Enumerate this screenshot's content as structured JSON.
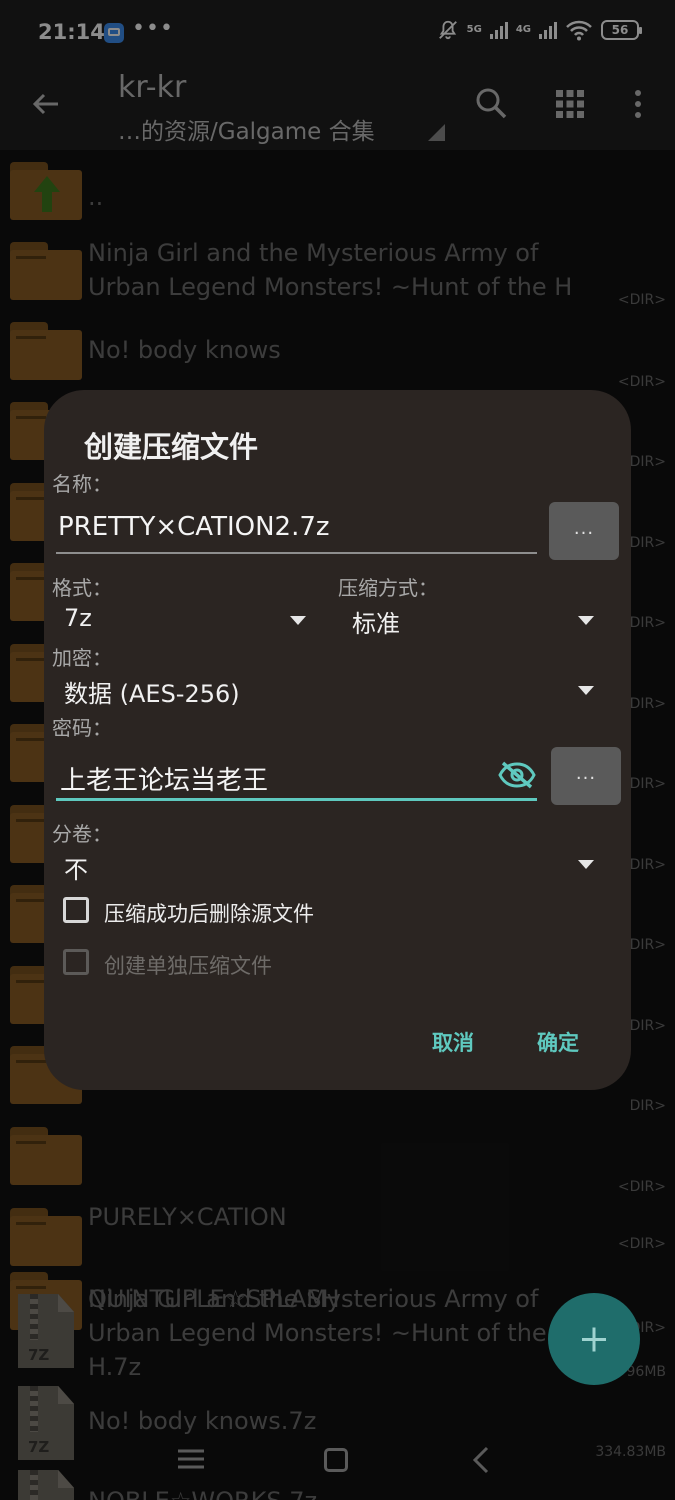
{
  "status_bar": {
    "time": "21:14",
    "dots": "•••",
    "network_5g": "5G",
    "network_4g": "4G",
    "battery": "56"
  },
  "toolbar": {
    "title": "kr-kr",
    "path": "…的资源/Galgame 合集"
  },
  "file_list": [
    {
      "name": "..",
      "meta": "",
      "kind": "up"
    },
    {
      "name_line1": "Ninja Girl and the Mysterious Army of",
      "name_line2": "Urban Legend Monsters! ~Hunt of the H",
      "meta": "<DIR>",
      "kind": "folder"
    },
    {
      "name": "No! body knows",
      "meta": "<DIR>",
      "kind": "folder"
    },
    {
      "name": "",
      "meta": "DIR>",
      "kind": "folder"
    },
    {
      "name": "",
      "meta": "DIR>",
      "kind": "folder"
    },
    {
      "name": "",
      "meta": "DIR>",
      "kind": "folder"
    },
    {
      "name": "",
      "meta": "DIR>",
      "kind": "folder"
    },
    {
      "name": "",
      "meta": "DIR>",
      "kind": "folder"
    },
    {
      "name": "",
      "meta": "DIR>",
      "kind": "folder"
    },
    {
      "name": "",
      "meta": "DIR>",
      "kind": "folder"
    },
    {
      "name": "",
      "meta": "DIR>",
      "kind": "folder"
    },
    {
      "name": "",
      "meta": "DIR>",
      "kind": "folder"
    },
    {
      "name": "",
      "meta": "<DIR>",
      "kind": "folder"
    },
    {
      "name": "PURELY×CATION",
      "meta": "<DIR>",
      "kind": "folder"
    },
    {
      "name": "QUINTUPLE☆SPLASH",
      "meta": "<DIR>",
      "kind": "folder"
    },
    {
      "name_line1": "Ninja Girl and the Mysterious Army of",
      "name_line2": "Urban Legend Monsters! ~Hunt of the",
      "name_line3": "H.7z",
      "meta": "96MB",
      "kind": "archive"
    },
    {
      "name": "No! body knows.7z",
      "meta": "334.83MB",
      "kind": "archive"
    },
    {
      "name": "NOBLE☆WORKS.7z",
      "meta": "",
      "kind": "archive"
    }
  ],
  "archive_badge": "7Z",
  "dialog": {
    "title": "创建压缩文件",
    "name_label": "名称：",
    "name_value": "PRETTY×CATION2.7z",
    "browse_label": "...",
    "format_label": "格式：",
    "format_value": "7z",
    "compression_label": "压缩方式：",
    "compression_value": "标准",
    "encryption_label": "加密：",
    "encryption_value": "数据 (AES-256)",
    "password_label": "密码：",
    "password_value": "上老王论坛当老王",
    "password_more": "...",
    "split_label": "分卷：",
    "split_value": "不",
    "delete_source_label": "压缩成功后删除源文件",
    "separate_archives_label": "创建单独压缩文件",
    "cancel_label": "取消",
    "ok_label": "确定"
  },
  "colors": {
    "accent": "#5fc9bf",
    "dialog_bg": "#2b2522",
    "folder": "#8a5d25"
  }
}
